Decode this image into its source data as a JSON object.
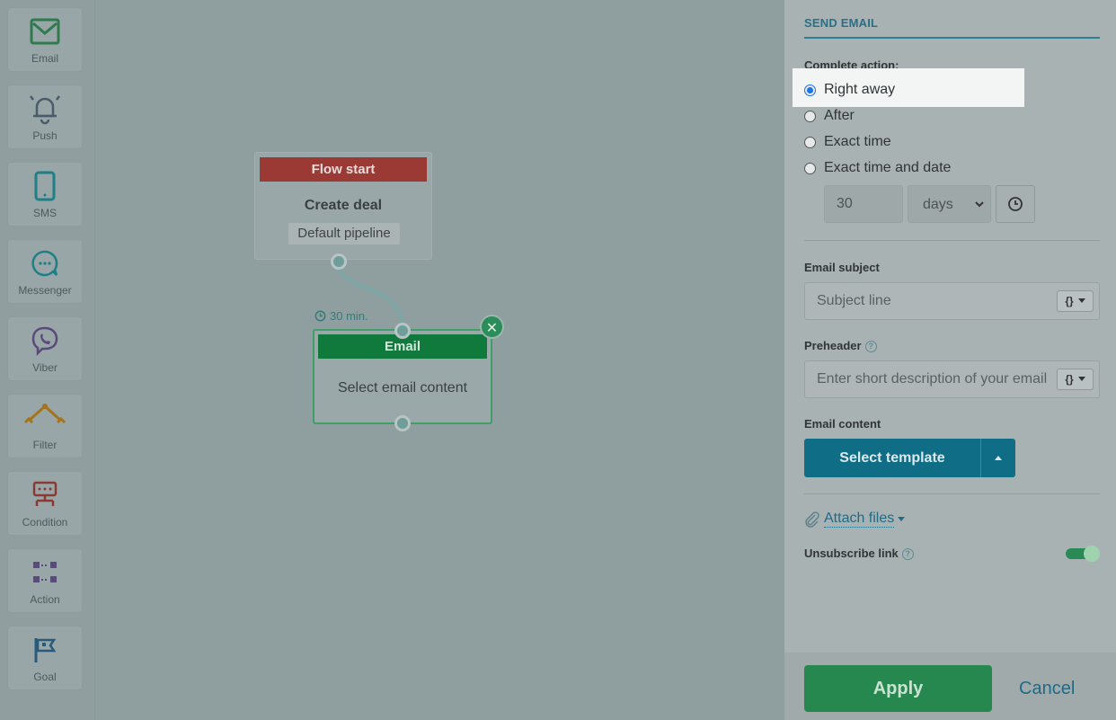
{
  "palette": {
    "items": [
      {
        "label": "Email",
        "icon": "envelope-icon"
      },
      {
        "label": "Push",
        "icon": "bell-icon"
      },
      {
        "label": "SMS",
        "icon": "phone-icon"
      },
      {
        "label": "Messenger",
        "icon": "chat-icon"
      },
      {
        "label": "Viber",
        "icon": "viber-icon"
      },
      {
        "label": "Filter",
        "icon": "filter-icon"
      },
      {
        "label": "Condition",
        "icon": "condition-icon"
      },
      {
        "label": "Action",
        "icon": "action-icon"
      },
      {
        "label": "Goal",
        "icon": "flag-icon"
      }
    ]
  },
  "canvas": {
    "start_node": {
      "header": "Flow start",
      "title": "Create deal",
      "pill": "Default pipeline"
    },
    "delay_label": "30 min.",
    "email_node": {
      "header": "Email",
      "body": "Select email content"
    },
    "close_symbol": "✕"
  },
  "panel": {
    "title": "SEND EMAIL",
    "complete_action_label": "Complete action:",
    "options": [
      "Right away",
      "After",
      "Exact time",
      "Exact time and date"
    ],
    "selected_option": "Right away",
    "delay_value": "30",
    "delay_unit": "days",
    "email_subject_label": "Email subject",
    "subject_placeholder": "Subject line",
    "preheader_label": "Preheader",
    "preheader_placeholder": "Enter short description of your email",
    "var_button_label": "{}",
    "email_content_label": "Email content",
    "select_template_label": "Select template",
    "attach_files_label": "Attach files",
    "unsubscribe_label": "Unsubscribe link",
    "unsubscribe_enabled": true,
    "help_symbol": "?"
  },
  "footer": {
    "apply_label": "Apply",
    "cancel_label": "Cancel"
  },
  "colors": {
    "flow_start": "#9b3a35",
    "email_header": "#0f7a3c",
    "accent": "#0f6e86",
    "apply": "#26884f"
  }
}
